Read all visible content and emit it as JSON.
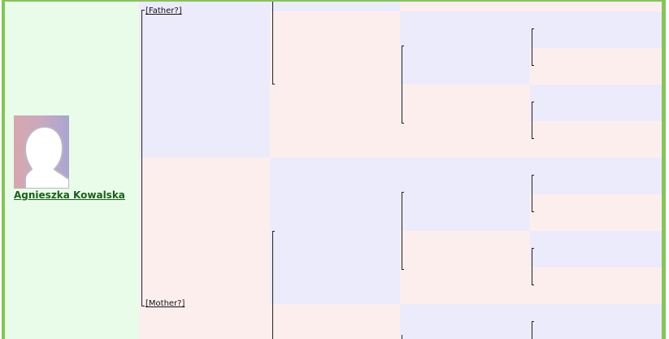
{
  "root_person": {
    "name": "Agnieszka Kowalska",
    "photo": "silhouette-photo"
  },
  "parents": {
    "father_label": "[Father?]",
    "mother_label": "[Mother?]"
  },
  "colors": {
    "border_green": "#86c45b",
    "root_bg": "#e9fce9",
    "male_bg": "#ecebfc",
    "female_bg": "#fdeeee",
    "name_link": "#1a5e1a"
  }
}
